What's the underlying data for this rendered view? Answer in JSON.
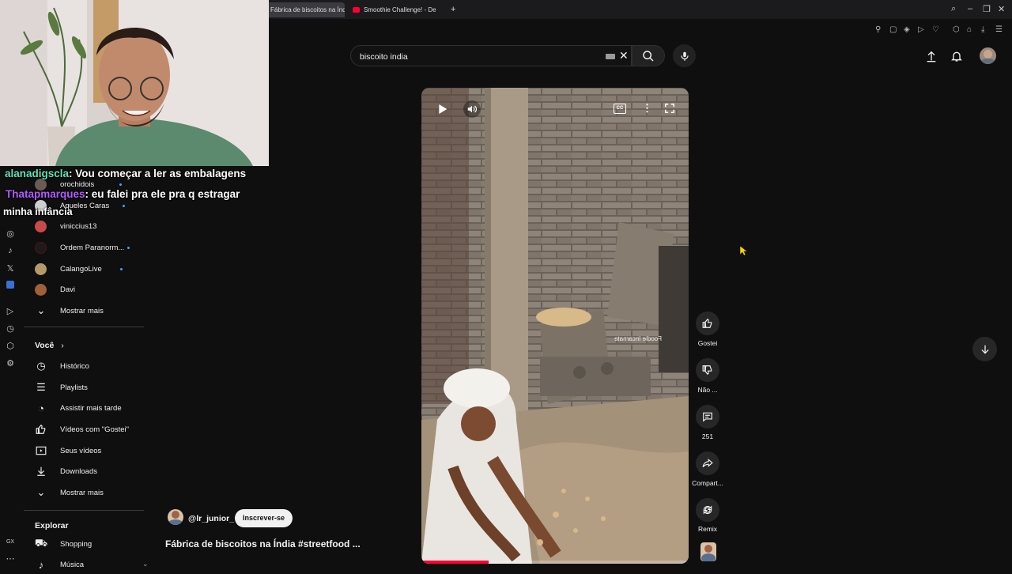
{
  "browser": {
    "tabs": [
      {
        "title": "Fábrica de biscoitos na Índ"
      },
      {
        "title": "Smoothie Challenge! - De"
      }
    ],
    "new_tab": "+"
  },
  "stream": {
    "chat": [
      {
        "user": "alanadigscla",
        "user_color": "#5fe3b6",
        "message": ": Vou começar a ler as embalagens"
      },
      {
        "user": "Thatapmarques",
        "user_color": "#b35cff",
        "message": ": eu falei pra ele pra q estragar"
      },
      {
        "user": "",
        "user_color": "#ffffff",
        "message": "minha infância"
      }
    ]
  },
  "search": {
    "value": "biscoito india"
  },
  "sidebar": {
    "subscriptions": [
      {
        "label": "orochidois",
        "dot": true
      },
      {
        "label": "Aqueles Caras",
        "dot": true
      },
      {
        "label": "viniccius13",
        "dot": false
      },
      {
        "label": "Ordem Paranorm...",
        "dot": true
      },
      {
        "label": "CalangoLive",
        "dot": true
      },
      {
        "label": "Davi",
        "dot": false
      },
      {
        "label": "Mostrar mais",
        "icon": "chevron-down-icon"
      }
    ],
    "you": {
      "heading": "Você",
      "items": [
        {
          "label": "Histórico",
          "icon": "history-icon"
        },
        {
          "label": "Playlists",
          "icon": "playlist-icon"
        },
        {
          "label": "Assistir mais tarde",
          "icon": "clock-icon"
        },
        {
          "label": "Vídeos com \"Gostei\"",
          "icon": "thumb-up-icon"
        },
        {
          "label": "Seus vídeos",
          "icon": "video-icon"
        },
        {
          "label": "Downloads",
          "icon": "download-icon"
        },
        {
          "label": "Mostrar mais",
          "icon": "chevron-down-icon"
        }
      ]
    },
    "explore": {
      "heading": "Explorar",
      "items": [
        {
          "label": "Shopping",
          "icon": "shopping-icon"
        },
        {
          "label": "Música",
          "icon": "music-icon"
        }
      ]
    }
  },
  "short": {
    "channel": "@lr_junior_",
    "subscribe_label": "Inscrever-se",
    "title": "Fábrica de biscoitos na Índia #streetfood ...",
    "watermark": "Foodie Incarnate",
    "progress": 0.25,
    "actions": [
      {
        "label": "Gostei",
        "icon": "thumb-up-icon"
      },
      {
        "label": "Não ...",
        "icon": "thumb-down-icon"
      },
      {
        "label": "251",
        "icon": "comment-icon"
      },
      {
        "label": "Compart...",
        "icon": "share-icon"
      },
      {
        "label": "Remix",
        "icon": "remix-icon"
      }
    ]
  },
  "colors": {
    "accent": "#ff0033",
    "subscribe_bg": "#f1f1f1",
    "link_dot": "#3ea6ff"
  }
}
